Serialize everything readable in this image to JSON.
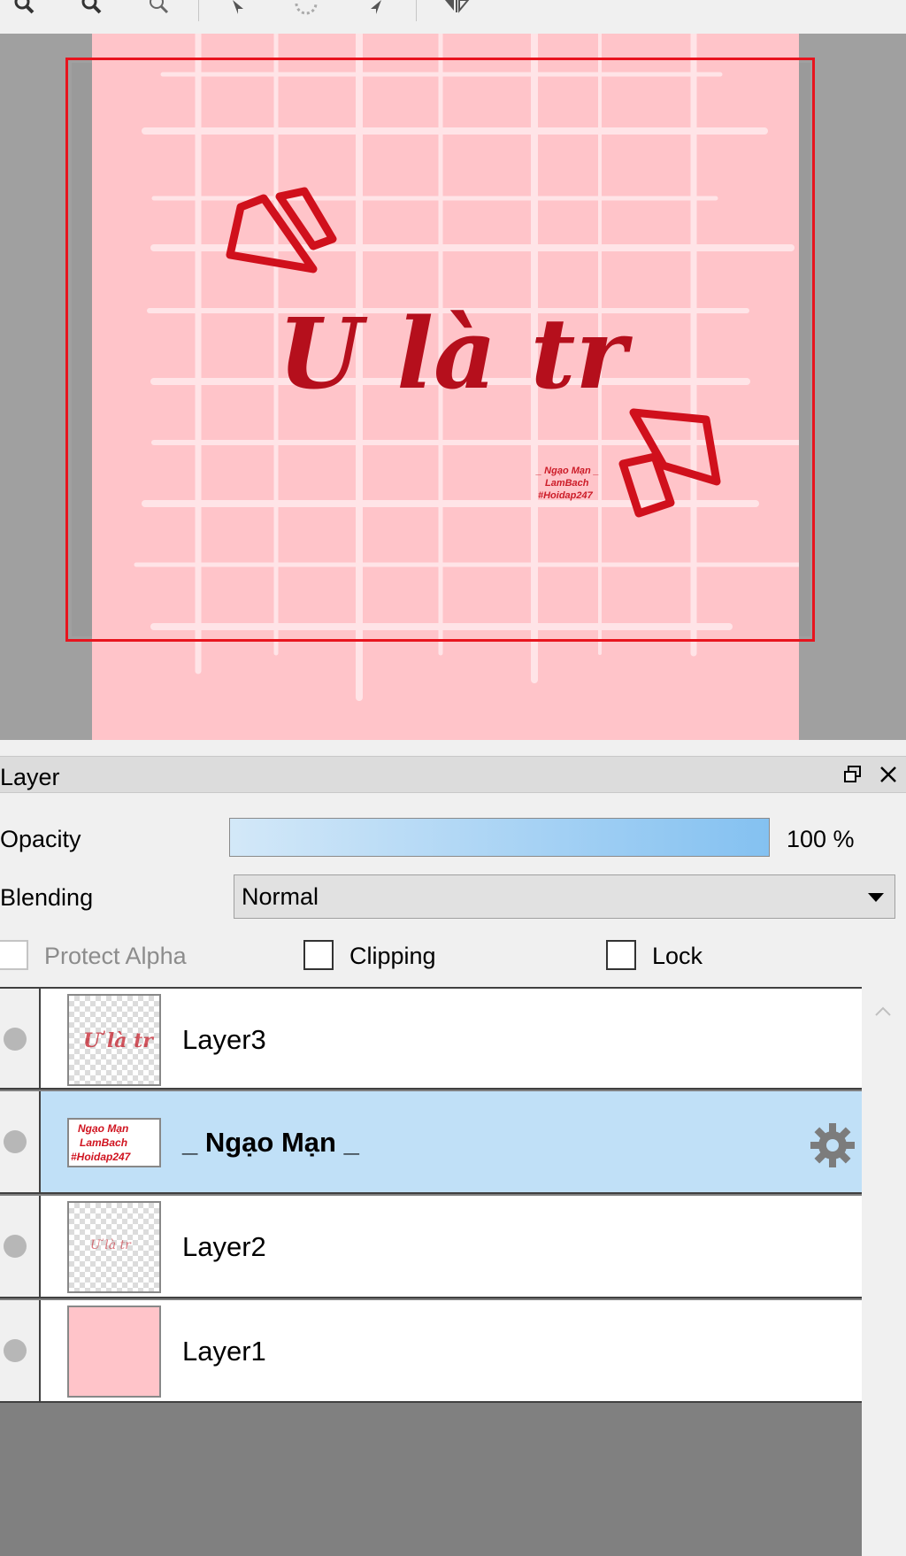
{
  "toolbar": {
    "tools": [
      {
        "icon": "zoom-in-icon"
      },
      {
        "icon": "zoom-out-icon"
      },
      {
        "icon": "zoom-fit-icon"
      },
      {
        "icon": "rotate-left-icon"
      },
      {
        "icon": "reset-rotation-icon"
      },
      {
        "icon": "rotate-right-icon"
      },
      {
        "icon": "flip-icon"
      }
    ]
  },
  "canvas": {
    "title_text": "U là tr",
    "signature_lines": [
      "_ Ngạo Mạn _",
      "LamBach",
      "#Hoidap247"
    ],
    "page_color": "#ffc4c9",
    "selection_color": "#e8141e"
  },
  "layer_panel": {
    "title": "Layer",
    "opacity_label": "Opacity",
    "opacity_value": "100 %",
    "opacity_fraction": 1.0,
    "blending_label": "Blending",
    "blending_value": "Normal",
    "protect_alpha_label": "Protect Alpha",
    "clipping_label": "Clipping",
    "lock_label": "Lock",
    "layers": [
      {
        "name": "Layer3",
        "selected": false
      },
      {
        "name": "_ Ngạo Mạn _",
        "selected": true,
        "thumb_text": [
          "Ngạo Mạn",
          "LamBach",
          "#Hoidap247"
        ]
      },
      {
        "name": "Layer2",
        "selected": false
      },
      {
        "name": "Layer1",
        "selected": false
      }
    ]
  }
}
